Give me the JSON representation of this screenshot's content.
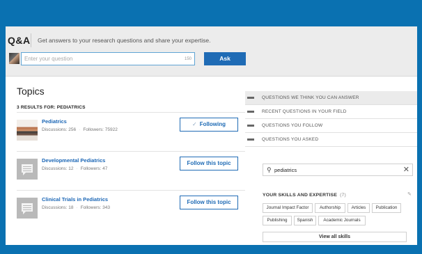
{
  "header": {
    "logo": "Q&A",
    "tagline": "Get answers to your research questions and share your expertise.",
    "question_placeholder": "Enter your question",
    "char_count": "150",
    "ask_label": "Ask"
  },
  "topics": {
    "title": "Topics",
    "results_label": "3 RESULTS FOR: PEDIATRICS",
    "items": [
      {
        "name": "Pediatrics",
        "discussions": "Discussions: 256",
        "followers": "Followers: 75922",
        "button": "Following",
        "button_icon": "check-icon"
      },
      {
        "name": "Developmental Pediatrics",
        "discussions": "Discussions: 12",
        "followers": "Followers: 47",
        "button": "Follow this topic"
      },
      {
        "name": "Clinical Trials in Pediatrics",
        "discussions": "Discussions: 18",
        "followers": "Followers: 343",
        "button": "Follow this topic"
      }
    ]
  },
  "side_menu": [
    "QUESTIONS WE THINK YOU CAN ANSWER",
    "RECENT QUESTIONS IN YOUR FIELD",
    "QUESTIONS YOU FOLLOW",
    "QUESTIONS YOU ASKED"
  ],
  "search": {
    "value": "pediatrics"
  },
  "skills": {
    "title": "YOUR SKILLS AND EXPERTISE",
    "count": "(7)",
    "tags": [
      "Journal Impact Factor",
      "Authorship",
      "Articles",
      "Publication",
      "Publishing",
      "Spanish",
      "Academic Journals"
    ],
    "view_all": "View all skills"
  },
  "colors": {
    "frame": "#0a71b1",
    "accent": "#1f6bb5"
  }
}
